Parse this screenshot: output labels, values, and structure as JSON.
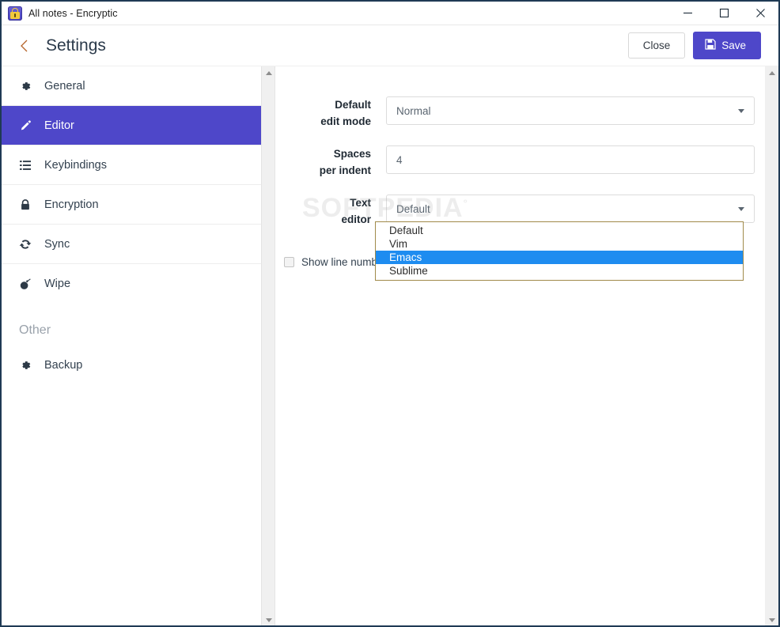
{
  "window": {
    "title": "All notes - Encryptic",
    "app_icon": "padlock-icon",
    "controls": {
      "minimize": "minimize-icon",
      "maximize": "maximize-icon",
      "close": "close-icon"
    }
  },
  "header": {
    "back_icon": "chevron-left-icon",
    "title": "Settings",
    "close_label": "Close",
    "save_label": "Save",
    "save_icon": "floppy-disk-icon",
    "accent_color": "#4e47c9"
  },
  "sidebar": {
    "items": [
      {
        "label": "General",
        "icon": "gear-icon",
        "active": false
      },
      {
        "label": "Editor",
        "icon": "pencil-icon",
        "active": true
      },
      {
        "label": "Keybindings",
        "icon": "list-icon",
        "active": false
      },
      {
        "label": "Encryption",
        "icon": "lock-icon",
        "active": false
      },
      {
        "label": "Sync",
        "icon": "refresh-icon",
        "active": false
      },
      {
        "label": "Wipe",
        "icon": "bomb-icon",
        "active": false
      }
    ],
    "group_label": "Other",
    "other_items": [
      {
        "label": "Backup",
        "icon": "gear-icon",
        "active": false
      }
    ]
  },
  "main": {
    "fields": [
      {
        "label_line1": "Default",
        "label_line2": "edit mode",
        "value": "Normal",
        "type": "select"
      },
      {
        "label_line1": "Spaces",
        "label_line2": "per indent",
        "value": "4",
        "type": "input"
      },
      {
        "label_line1": "Text",
        "label_line2": "editor",
        "value": "Default",
        "type": "select"
      }
    ],
    "checkbox": {
      "label": "Show line numbers",
      "checked": false
    },
    "dropdown": {
      "open": true,
      "options": [
        "Default",
        "Vim",
        "Emacs",
        "Sublime"
      ],
      "highlighted": "Emacs",
      "border_color": "#a08a4a",
      "highlight_color": "#1e8cf0"
    }
  },
  "watermark": {
    "text": "SOFTPEDIA",
    "mark": "°"
  }
}
